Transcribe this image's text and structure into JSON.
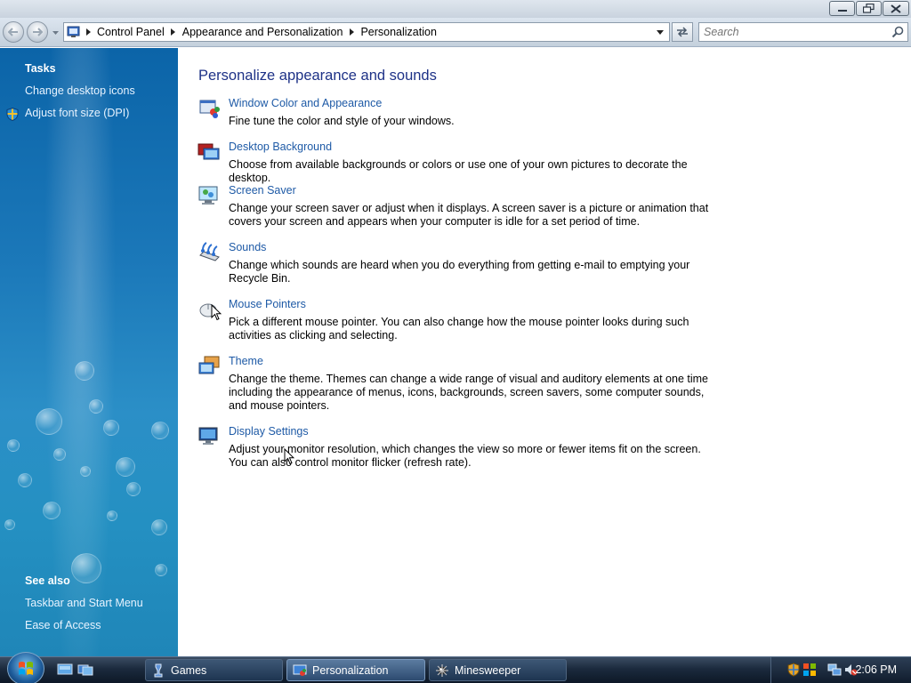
{
  "window": {
    "minimize_icon": "minimize-icon",
    "maximize_icon": "restore-icon",
    "close_icon": "close-icon"
  },
  "address_bar": {
    "breadcrumbs": [
      "Control Panel",
      "Appearance and Personalization",
      "Personalization"
    ],
    "search_placeholder": "Search"
  },
  "task_pane": {
    "tasks_title": "Tasks",
    "tasks": [
      {
        "label": "Change desktop icons",
        "icon": ""
      },
      {
        "label": "Adjust font size (DPI)",
        "icon": "uac-shield-icon"
      }
    ],
    "see_also_title": "See also",
    "see_also": [
      {
        "label": "Taskbar and Start Menu"
      },
      {
        "label": "Ease of Access"
      }
    ]
  },
  "main": {
    "title": "Personalize appearance and sounds",
    "items": [
      {
        "label": "Window Color and Appearance",
        "description": "Fine tune the color and style of your windows.",
        "icon": "window-color-icon"
      },
      {
        "label": "Desktop Background",
        "description": "Choose from available backgrounds or colors or use one of your own pictures to decorate the desktop.",
        "icon": "desktop-background-icon"
      },
      {
        "label": "Screen Saver",
        "description": "Change your screen saver or adjust when it displays. A screen saver is a picture or animation that covers your screen and appears when your computer is idle for a set period of time.",
        "icon": "screen-saver-icon"
      },
      {
        "label": "Sounds",
        "description": "Change which sounds are heard when you do everything from getting e-mail to emptying your Recycle Bin.",
        "icon": "sounds-icon"
      },
      {
        "label": "Mouse Pointers",
        "description": "Pick a different mouse pointer. You can also change how the mouse pointer looks during such activities as clicking and selecting.",
        "icon": "mouse-pointers-icon"
      },
      {
        "label": "Theme",
        "description": "Change the theme. Themes can change a wide range of visual and auditory elements at one time including the appearance of menus, icons, backgrounds, screen savers, some computer sounds, and mouse pointers.",
        "icon": "theme-icon"
      },
      {
        "label": "Display Settings",
        "description": "Adjust your monitor resolution, which changes the view so more or fewer items fit on the screen. You can also control monitor flicker (refresh rate).",
        "icon": "display-settings-icon"
      }
    ]
  },
  "taskbar": {
    "start_icon": "windows-start-orb-icon",
    "quick_launch": [
      "show-desktop-icon",
      "switch-windows-icon"
    ],
    "buttons": [
      {
        "label": "Games",
        "icon": "games-icon",
        "active": false
      },
      {
        "label": "Personalization",
        "icon": "personalization-icon",
        "active": true
      },
      {
        "label": "Minesweeper",
        "icon": "minesweeper-icon",
        "active": false
      }
    ],
    "tray_icons": [
      "security-shield-icon",
      "windows-security-icon",
      "network-icon",
      "volume-muted-icon"
    ],
    "clock": "2:06 PM"
  },
  "colors": {
    "link": "#1e5aa6",
    "title": "#1e3287",
    "task_pane": "#1b78b9"
  }
}
